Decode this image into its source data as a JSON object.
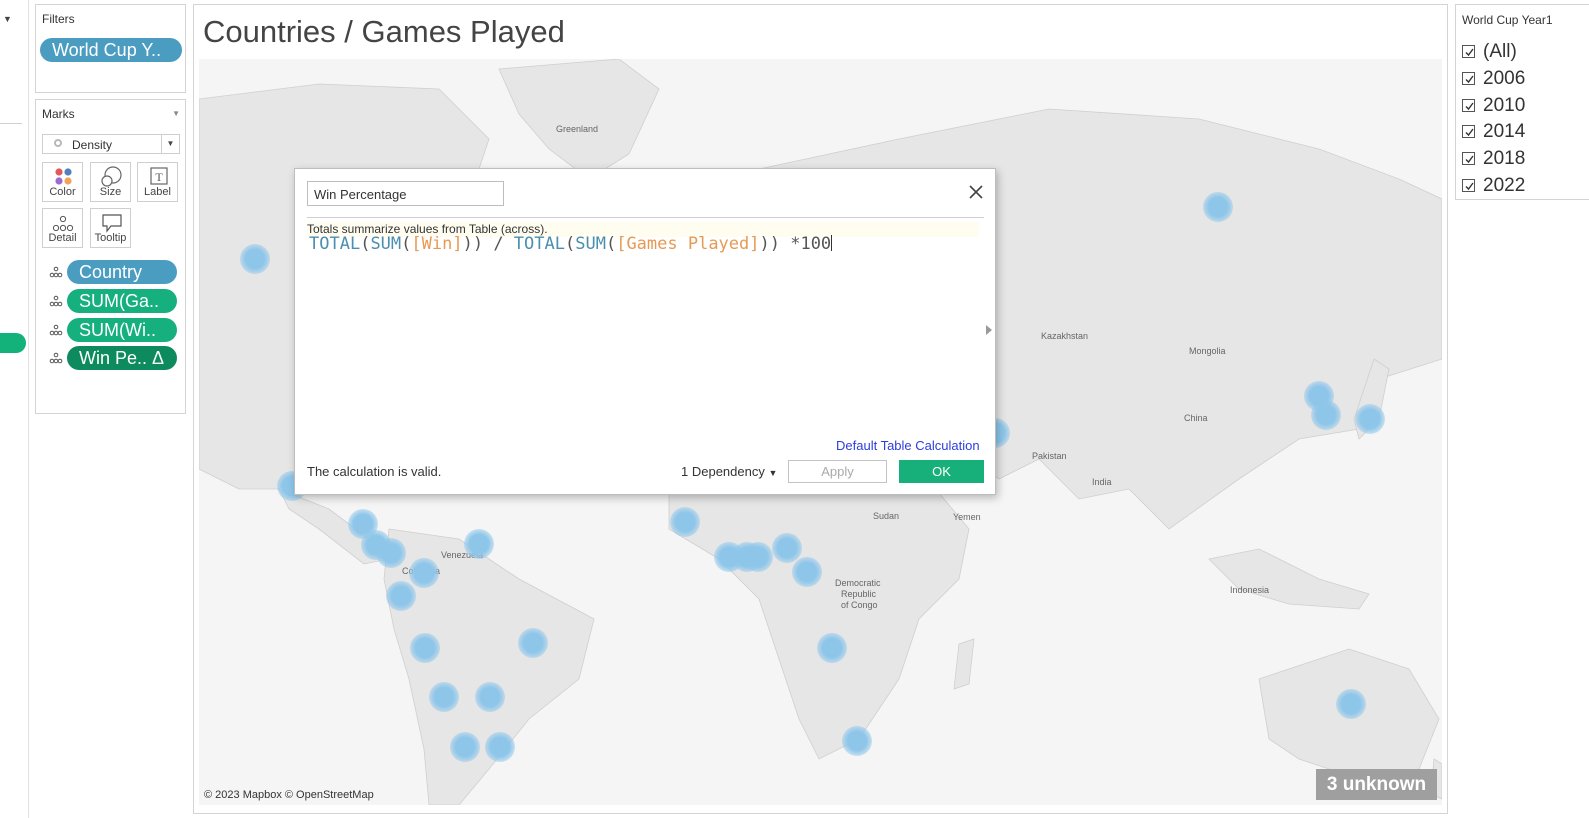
{
  "filters": {
    "title": "Filters",
    "pill": "World Cup Y.."
  },
  "marks": {
    "title": "Marks",
    "mark_type": "Density",
    "buttons": [
      "Color",
      "Size",
      "Label",
      "Detail",
      "Tooltip"
    ],
    "fields": [
      "Country",
      "SUM(Ga..",
      "SUM(Wi..",
      "Win Pe.. Δ"
    ]
  },
  "view": {
    "title": "Countries / Games Played",
    "attribution": "© 2023 Mapbox © OpenStreetMap",
    "unknown_badge": "3 unknown",
    "map_labels": [
      "Greenland",
      "Kazakhstan",
      "Mongolia",
      "China",
      "Pakistan",
      "India",
      "Sudan",
      "Yemen",
      "Democratic",
      "Republic",
      "of Congo",
      "Indonesia",
      "Venezuela",
      "Colombia"
    ]
  },
  "quick_filter": {
    "title": "World Cup Year1",
    "items": [
      {
        "label": "(All)",
        "checked": true
      },
      {
        "label": "2006",
        "checked": true
      },
      {
        "label": "2010",
        "checked": true
      },
      {
        "label": "2014",
        "checked": true
      },
      {
        "label": "2018",
        "checked": true
      },
      {
        "label": "2022",
        "checked": true
      }
    ]
  },
  "dialog": {
    "name": "Win Percentage",
    "hint": "Totals summarize values from Table (across).",
    "formula": {
      "total1": "TOTAL",
      "sum1": "SUM",
      "field1": "[Win]",
      "divide": " / ",
      "total2": "TOTAL",
      "sum2": "SUM",
      "field2": "[Games Played]",
      "tail": " *100"
    },
    "default_table_calc": "Default Table Calculation",
    "status": "The calculation is valid.",
    "dependency": "1 Dependency",
    "apply": "Apply",
    "ok": "OK"
  },
  "colors": {
    "density": "#8ec6ea",
    "accent_green": "#17b07b",
    "pill_blue": "#4a9dc1"
  }
}
